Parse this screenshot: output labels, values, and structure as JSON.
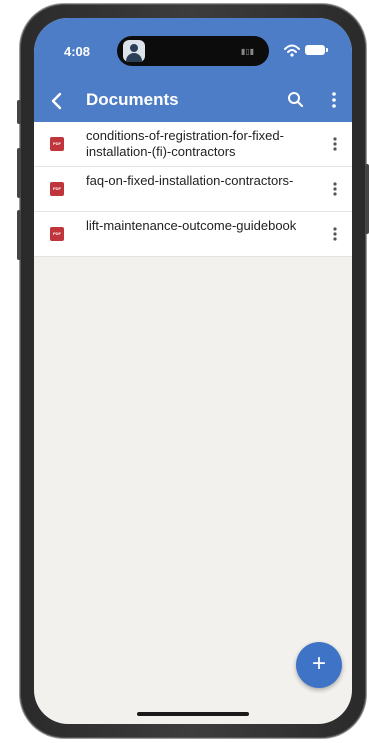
{
  "status_bar": {
    "time": "4:08"
  },
  "app_bar": {
    "title": "Documents",
    "back_icon": "chevron-left-icon",
    "search_icon": "search-icon",
    "more_icon": "more-vertical-icon"
  },
  "documents": [
    {
      "title": "conditions-of-registration-for-fixed-installation-(fi)-contractors",
      "icon": "pdf-icon"
    },
    {
      "title": "faq-on-fixed-installation-contractors-",
      "icon": "pdf-icon"
    },
    {
      "title": "lift-maintenance-outcome-guidebook",
      "icon": "pdf-icon"
    }
  ],
  "pdf_label": "PDF",
  "fab": {
    "label": "+",
    "icon": "add-icon"
  },
  "colors": {
    "primary": "#4e7dc8",
    "fab": "#3f73c6",
    "pdf": "#c0343b",
    "background": "#f2f1ee"
  }
}
